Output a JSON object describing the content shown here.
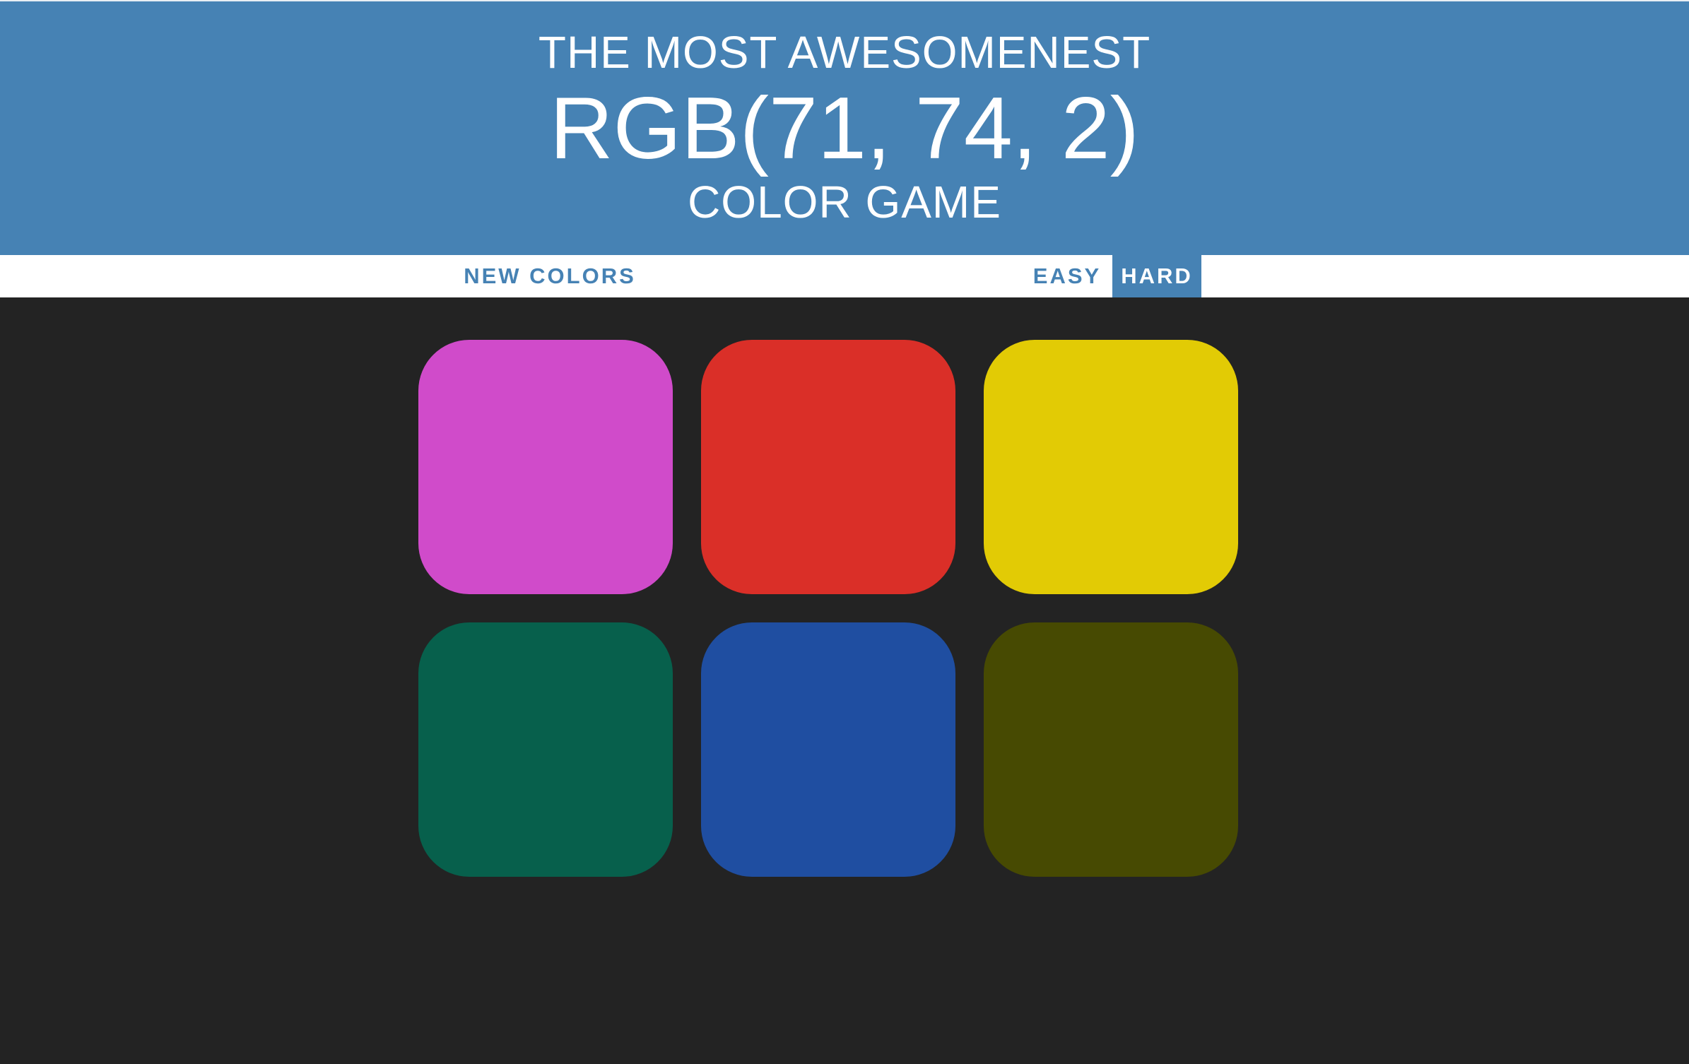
{
  "header": {
    "line1": "THE MOST AWESOMENEST",
    "target_color": "RGB(71, 74, 2)",
    "line3": "COLOR GAME",
    "background": "#4682b4"
  },
  "stripe": {
    "new_colors_label": "NEW COLORS",
    "message": "",
    "modes": [
      {
        "label": "EASY",
        "selected": false
      },
      {
        "label": "HARD",
        "selected": true
      }
    ]
  },
  "board": {
    "background": "#232323",
    "squares": [
      {
        "color": "#d04bca"
      },
      {
        "color": "#da2f28"
      },
      {
        "color": "#e2cb05"
      },
      {
        "color": "#07604c"
      },
      {
        "color": "#1f4ea1"
      },
      {
        "color": "#474a02"
      }
    ]
  }
}
